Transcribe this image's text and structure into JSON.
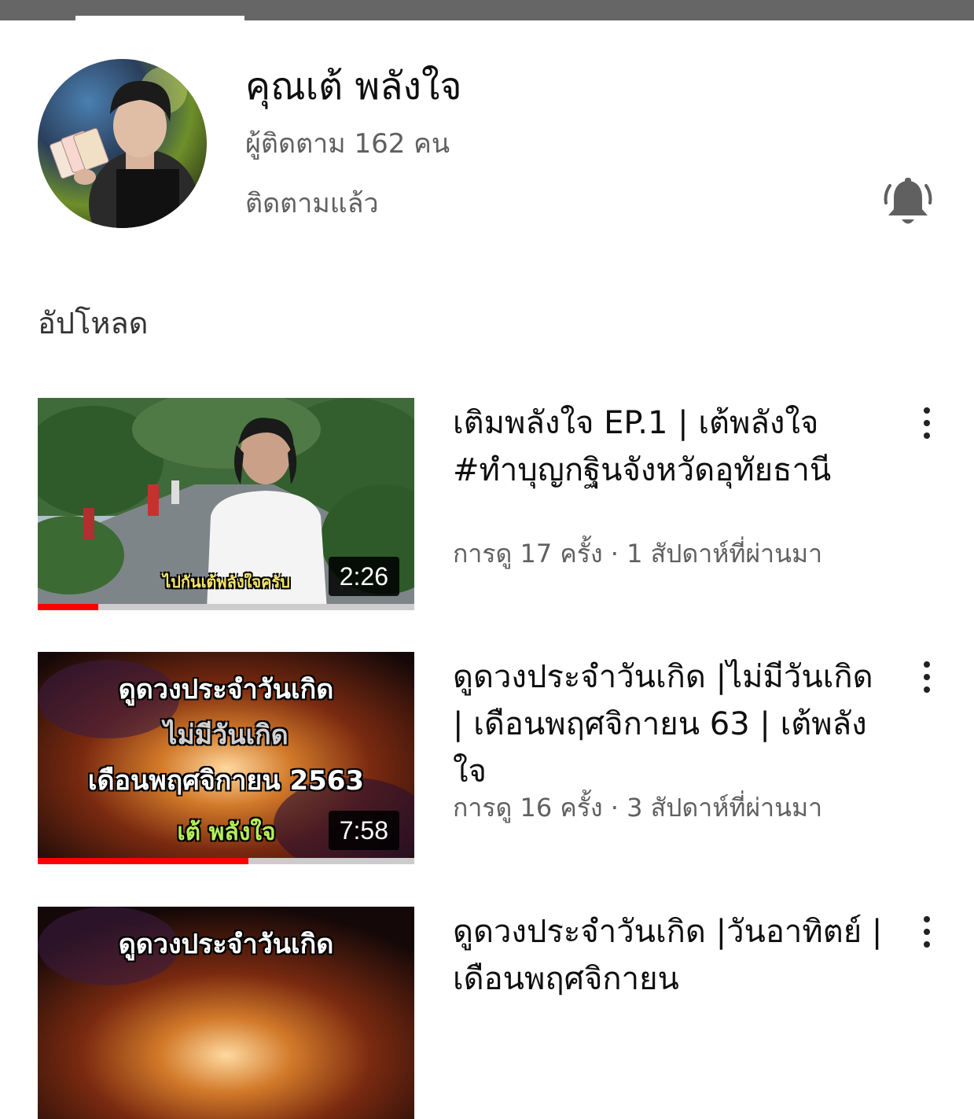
{
  "channel": {
    "name": "คุณเต้ พลังใจ",
    "subscribers": "ผู้ติดตาม 162 คน",
    "subscribe_status": "ติดตามแล้ว"
  },
  "section": {
    "title": "อัปโหลด"
  },
  "videos": [
    {
      "title": "เติมพลังใจ EP.1 | เต้พลังใจ #ทำบุญกฐินจังหวัดอุทัยธานี",
      "meta": "การดู 17 ครั้ง · 1 สัปดาห์ที่ผ่านมา",
      "duration": "2:26",
      "watched_fraction": 0.16,
      "thumb_caption": "ไปกันเต้พลังใจครับ"
    },
    {
      "title": "ดูดวงประจำวันเกิด |ไม่มีวันเกิด | เดือนพฤศจิกายน 63 | เต้พลังใจ",
      "meta": "การดู 16 ครั้ง · 3 สัปดาห์ที่ผ่านมา",
      "duration": "7:58",
      "watched_fraction": 0.56,
      "thumb_lines": [
        "ดูดวงประจำวันเกิด",
        "ไม่มีวันเกิด",
        "เดือนพฤศจิกายน  2563",
        "เต้  พลังใจ"
      ]
    },
    {
      "title": "ดูดวงประจำวันเกิด |วันอาทิตย์ | เดือนพฤศจิกายน",
      "thumb_lines": [
        "ดูดวงประจำวันเกิด"
      ]
    }
  ],
  "icons": {
    "bell": "bell-ringing-icon",
    "more": "more-vert-icon"
  },
  "colors": {
    "progress": "#ff0000",
    "secondary_text": "#606060"
  }
}
